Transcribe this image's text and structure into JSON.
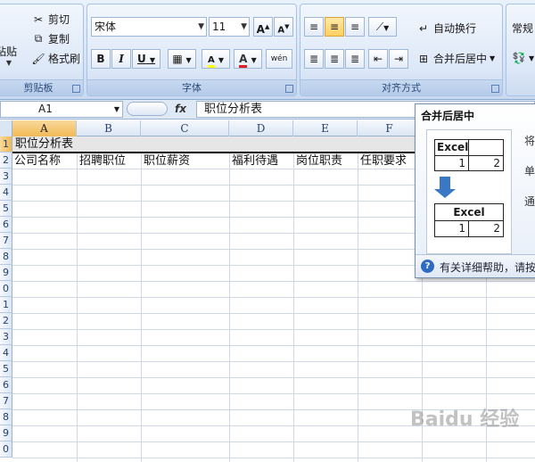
{
  "ribbon": {
    "clipboard": {
      "paste": "粘贴",
      "cut": "剪切",
      "copy": "复制",
      "format_painter": "格式刷",
      "title": "剪贴板"
    },
    "font": {
      "name": "宋体",
      "size": "11",
      "grow": "A",
      "shrink": "A",
      "bold": "B",
      "italic": "I",
      "underline": "U",
      "fill_letter": "A",
      "color_letter": "A",
      "phonetic": "wén",
      "title": "字体"
    },
    "alignment": {
      "wrap": "自动换行",
      "merge": "合并后居中",
      "title": "对齐方式"
    },
    "number": {
      "format": "常规"
    }
  },
  "formula_bar": {
    "name_box": "A1",
    "fx": "fx",
    "content": "职位分析表"
  },
  "grid": {
    "columns": [
      "A",
      "B",
      "C",
      "D",
      "E",
      "F"
    ],
    "row_numbers": [
      "1",
      "2",
      "3",
      "4",
      "5",
      "6",
      "7",
      "8",
      "9",
      "0",
      "1",
      "2",
      "3",
      "4",
      "5",
      "6",
      "7",
      "8",
      "9",
      "0"
    ],
    "row1_text": "职位分析表",
    "row2": [
      "公司名称",
      "招聘职位",
      "职位薪资",
      "福利待遇",
      "岗位职责",
      "任职要求"
    ]
  },
  "tooltip": {
    "title": "合并后居中",
    "before_label": "Excel",
    "before_vals": [
      "1",
      "2"
    ],
    "after_label": "Excel",
    "after_vals": [
      "1",
      "2"
    ],
    "side": [
      "将",
      "单",
      "通"
    ],
    "help": "有关详细帮助，请按"
  },
  "watermark": "Baidu 经验",
  "colors": {
    "accent": "#2f6bc1",
    "selected_header": "#f1b955",
    "ribbon": "#d6e4f6"
  }
}
